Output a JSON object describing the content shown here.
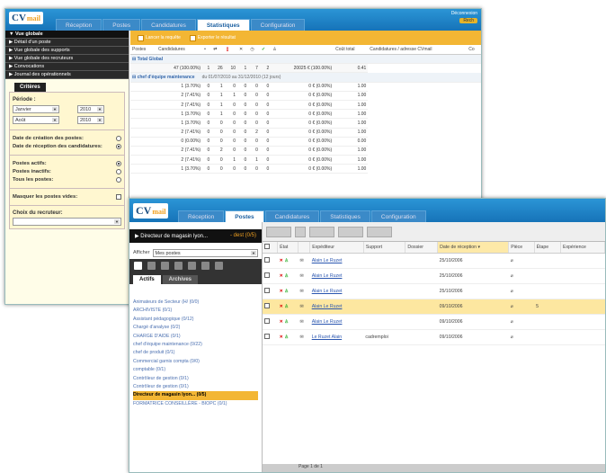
{
  "window1": {
    "logo": {
      "text": "CV",
      "suffix": "mail"
    },
    "tabs": [
      "Réception",
      "Postes",
      "Candidatures",
      "Statistiques",
      "Configuration"
    ],
    "top_right": {
      "line1": "Déconnexion",
      "badge": "Rech"
    },
    "nav": [
      "Vue globale",
      "Détail d'un poste",
      "Vue globale des supports",
      "Vue globale des recruteurs",
      "Convocations",
      "Journal des opérationnels"
    ],
    "criteria_tab": "Critères",
    "period_label": "Période :",
    "period_from": {
      "month": "Janvier",
      "year": "2010"
    },
    "period_to": {
      "month": "Août",
      "year": "2010"
    },
    "date_options": [
      {
        "label": "Date de création des postes:",
        "checked": false
      },
      {
        "label": "Date de réception des candidatures:",
        "checked": true
      }
    ],
    "post_options": [
      {
        "label": "Postes actifs:",
        "checked": true
      },
      {
        "label": "Postes inactifs:",
        "checked": false
      },
      {
        "label": "Tous les postes:",
        "checked": false
      }
    ],
    "hide_empty": "Masquer les postes vides:",
    "recruiter_label": "Choix du recruteur:",
    "toolbar": {
      "run": "Lancer la requête",
      "export": "Exporter le résultat"
    },
    "headers": [
      "Postes",
      "Candidatures",
      "",
      "",
      "",
      "",
      "",
      "",
      "",
      "Coût total",
      "Candidatures / adresse CVmail",
      "Co"
    ],
    "total_label": "Total Global",
    "total_row": [
      "47 (100.00%)",
      "1",
      "26",
      "10",
      "1",
      "7",
      "2",
      "20025 € (100.00%)",
      "0.41"
    ],
    "group_label": "chef d'équipe maintenance",
    "group_period": "du 01/07/2010 au 31/12/2010 (12 jours)",
    "rows": [
      [
        "1 (3.70%)",
        "0",
        "1",
        "0",
        "0",
        "0",
        "0",
        "0 € (0.00%)",
        "1.00"
      ],
      [
        "2 (7.41%)",
        "0",
        "1",
        "1",
        "0",
        "0",
        "0",
        "0 € (0.00%)",
        "1.00"
      ],
      [
        "2 (7.41%)",
        "0",
        "1",
        "0",
        "0",
        "0",
        "0",
        "0 € (0.00%)",
        "1.00"
      ],
      [
        "1 (3.70%)",
        "0",
        "1",
        "0",
        "0",
        "0",
        "0",
        "0 € (0.00%)",
        "1.00"
      ],
      [
        "1 (3.70%)",
        "0",
        "0",
        "0",
        "0",
        "0",
        "0",
        "0 € (0.00%)",
        "1.00"
      ],
      [
        "2 (7.41%)",
        "0",
        "0",
        "0",
        "0",
        "2",
        "0",
        "0 € (0.00%)",
        "1.00"
      ],
      [
        "0 (0.00%)",
        "0",
        "0",
        "0",
        "0",
        "0",
        "0",
        "0 € (0.00%)",
        "0.00"
      ],
      [
        "2 (7.41%)",
        "0",
        "2",
        "0",
        "0",
        "0",
        "0",
        "0 € (0.00%)",
        "1.00"
      ],
      [
        "2 (7.41%)",
        "0",
        "0",
        "1",
        "0",
        "1",
        "0",
        "0 € (0.00%)",
        "1.00"
      ],
      [
        "1 (3.70%)",
        "0",
        "0",
        "0",
        "0",
        "0",
        "0",
        "0 € (0.00%)",
        "1.00"
      ]
    ]
  },
  "window2": {
    "logo": {
      "text": "CV",
      "suffix": "mail"
    },
    "tabs": [
      "Réception",
      "Postes",
      "Candidatures",
      "Statistiques",
      "Configuration"
    ],
    "job_title": "Directeur de magasin lyon...",
    "job_count": "- dest (0/5)",
    "display_label": "Afficher",
    "display_value": "Mes postes",
    "subtabs": [
      "Actifs",
      "Archives"
    ],
    "posts": [
      "Animateurs de Secteur (H/ (0/0)",
      "ARCHIVISTE (0/1)",
      "Assistant pédagogique (0/12)",
      "Chargé d'analyse (0/2)",
      "CHARGE D'AIDE (0/1)",
      "chef d'équipe maintenance (0/22)",
      "chef de produit (0/1)",
      "Commercial garnis compta (0/0)",
      "comptable (0/1)",
      "Contrôleur de gestion (0/1)",
      "Contrôleur de gestion (0/1)",
      "Directeur de magasin lyon... (0/5)",
      "FORMATRICE CONSEILLÈRE - BIOPC (0/1)"
    ],
    "headers": [
      "",
      "État",
      "",
      "Expéditeur",
      "Support",
      "Dossier",
      "Date de réception",
      "Pièce",
      "Étape",
      "Expérience"
    ],
    "rows": [
      {
        "sender": "Alain Le Ruzet",
        "support": "",
        "date": "25/10/2006",
        "step": "",
        "highlight": false
      },
      {
        "sender": "Alain Le Ruzet",
        "support": "",
        "date": "25/10/2006",
        "step": "",
        "highlight": false
      },
      {
        "sender": "Alain Le Ruzet",
        "support": "",
        "date": "25/10/2006",
        "step": "",
        "highlight": false
      },
      {
        "sender": "Alain Le Ruzet",
        "support": "",
        "date": "09/10/2006",
        "step": "5",
        "highlight": true
      },
      {
        "sender": "Alain Le Ruzet",
        "support": "",
        "date": "09/10/2006",
        "step": "",
        "highlight": false
      },
      {
        "sender": "Le Ruzet Alain",
        "support": "cadremploi",
        "date": "09/10/2006",
        "step": "",
        "highlight": false
      }
    ],
    "pager": "Page 1 de 1"
  }
}
